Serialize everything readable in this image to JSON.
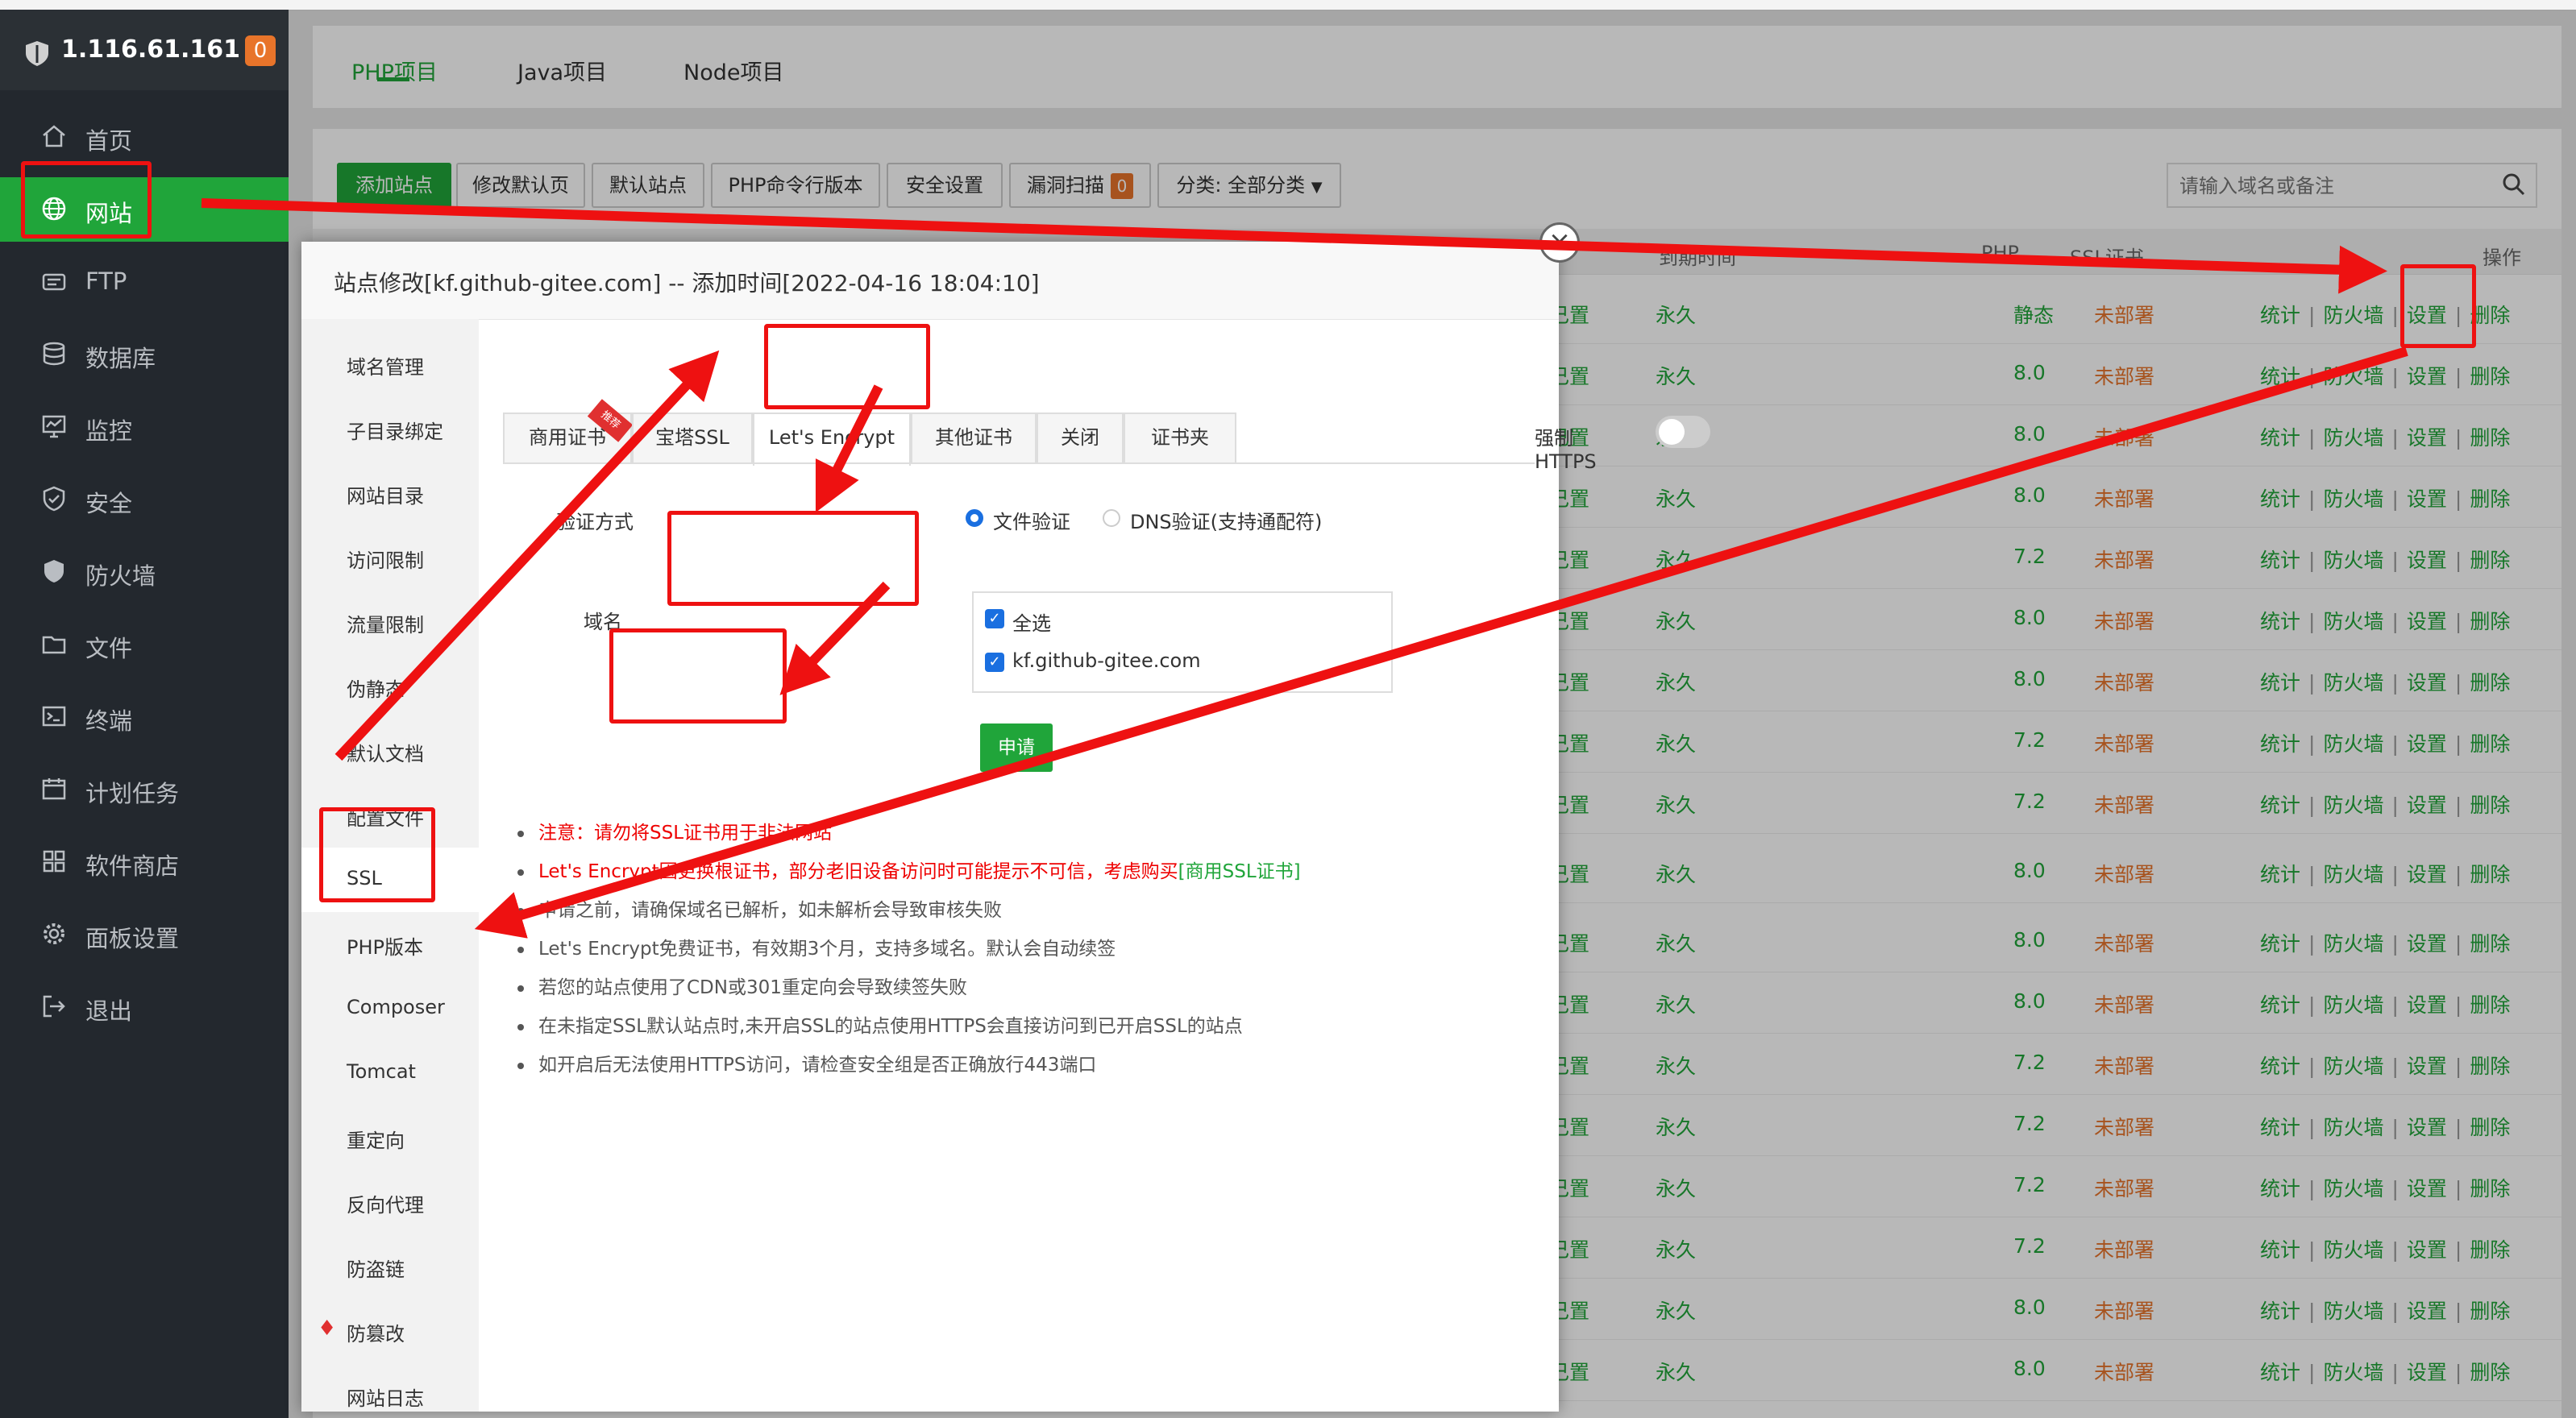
{
  "sidebar": {
    "server_ip": "1.116.61.161",
    "badge_count": "0",
    "items": [
      {
        "label": "首页",
        "icon": "home-icon"
      },
      {
        "label": "网站",
        "icon": "globe-icon",
        "active": true
      },
      {
        "label": "FTP",
        "icon": "ftp-icon"
      },
      {
        "label": "数据库",
        "icon": "database-icon"
      },
      {
        "label": "监控",
        "icon": "monitor-icon"
      },
      {
        "label": "安全",
        "icon": "shield-icon"
      },
      {
        "label": "防火墙",
        "icon": "firewall-icon"
      },
      {
        "label": "文件",
        "icon": "folder-icon"
      },
      {
        "label": "终端",
        "icon": "terminal-icon"
      },
      {
        "label": "计划任务",
        "icon": "calendar-icon"
      },
      {
        "label": "软件商店",
        "icon": "grid-icon"
      },
      {
        "label": "面板设置",
        "icon": "gear-icon"
      },
      {
        "label": "退出",
        "icon": "logout-icon"
      }
    ]
  },
  "project_tabs": [
    "PHP项目",
    "Java项目",
    "Node项目"
  ],
  "toolbar": {
    "add_site": "添加站点",
    "modify_default_page": "修改默认页",
    "default_site": "默认站点",
    "php_cli_version": "PHP命令行版本",
    "security_settings": "安全设置",
    "vuln_scan": "漏洞扫描",
    "vuln_count": "0",
    "category": "分类: 全部分类",
    "search_placeholder": "请输入域名或备注"
  },
  "table": {
    "headers": {
      "expire": "到期时间",
      "php": "PHP",
      "ssl": "SSL证书",
      "ops": "操作"
    },
    "ops_labels": {
      "stats": "统计",
      "firewall": "防火墙",
      "settings": "设置",
      "delete": "删除"
    },
    "rows": [
      {
        "note": "己置",
        "expire": "永久",
        "php": "静态",
        "ssl": "未部署"
      },
      {
        "note": "己置",
        "expire": "永久",
        "php": "8.0",
        "ssl": "未部署"
      },
      {
        "note": "己置",
        "expire": "永久",
        "php": "8.0",
        "ssl": "未部署"
      },
      {
        "note": "己置",
        "expire": "永久",
        "php": "8.0",
        "ssl": "未部署"
      },
      {
        "note": "己置",
        "expire": "永久",
        "php": "7.2",
        "ssl": "未部署"
      },
      {
        "note": "己置",
        "expire": "永久",
        "php": "8.0",
        "ssl": "未部署"
      },
      {
        "note": "己置",
        "expire": "永久",
        "php": "8.0",
        "ssl": "未部署"
      },
      {
        "note": "己置",
        "expire": "永久",
        "php": "7.2",
        "ssl": "未部署"
      },
      {
        "note": "己置",
        "expire": "永久",
        "php": "7.2",
        "ssl": "未部署"
      },
      {
        "note": "己置",
        "expire": "永久",
        "php": "8.0",
        "ssl": "未部署"
      },
      {
        "note": "己置",
        "expire": "永久",
        "php": "8.0",
        "ssl": "未部署"
      },
      {
        "note": "己置",
        "expire": "永久",
        "php": "8.0",
        "ssl": "未部署"
      },
      {
        "note": "己置",
        "expire": "永久",
        "php": "7.2",
        "ssl": "未部署"
      },
      {
        "note": "己置",
        "expire": "永久",
        "php": "7.2",
        "ssl": "未部署"
      },
      {
        "note": "己置",
        "expire": "永久",
        "php": "7.2",
        "ssl": "未部署"
      },
      {
        "note": "己置",
        "expire": "永久",
        "php": "7.2",
        "ssl": "未部署"
      },
      {
        "note": "己置",
        "expire": "永久",
        "php": "8.0",
        "ssl": "未部署"
      },
      {
        "note": "己置",
        "expire": "永久",
        "php": "8.0",
        "ssl": "未部署"
      }
    ]
  },
  "modal": {
    "title": "站点修改[kf.github-gitee.com] -- 添加时间[2022-04-16 18:04:10]",
    "close_glyph": "×",
    "nav": [
      "域名管理",
      "子目录绑定",
      "网站目录",
      "访问限制",
      "流量限制",
      "伪静态",
      "默认文档",
      "配置文件",
      "SSL",
      "PHP版本",
      "Composer",
      "Tomcat",
      "重定向",
      "反向代理",
      "防盗链",
      "防篡改",
      "网站日志"
    ],
    "ssl_tabs": [
      "商用证书",
      "宝塔SSL",
      "Let's Encrypt",
      "其他证书",
      "关闭",
      "证书夹"
    ],
    "ribbon": "推荐",
    "force_https": "强制HTTPS",
    "verify_label": "验证方式",
    "verify_file": "文件验证",
    "verify_dns": "DNS验证(支持通配符)",
    "domain_label": "域名",
    "select_all": "全选",
    "domain_value": "kf.github-gitee.com",
    "apply": "申请",
    "notes": [
      {
        "text": "注意：请勿将SSL证书用于非法网站",
        "red": true
      },
      {
        "text": "Let's Encrypt因更换根证书，部分老旧设备访问时可能提示不可信，考虑购买",
        "link": "[商用SSL证书]",
        "red": true
      },
      {
        "text": "申请之前，请确保域名已解析，如未解析会导致审核失败"
      },
      {
        "text": "Let's Encrypt免费证书，有效期3个月，支持多域名。默认会自动续签"
      },
      {
        "text": "若您的站点使用了CDN或301重定向会导致续签失败"
      },
      {
        "text": "在未指定SSL默认站点时,未开启SSL的站点使用HTTPS会直接访问到已开启SSL的站点"
      },
      {
        "text": "如开启后无法使用HTTPS访问，请检查安全组是否正确放行443端口"
      }
    ]
  },
  "colors": {
    "accent": "#20a53a",
    "sidebar": "#23282e",
    "annotation": "#ee1111",
    "warning": "#e8742a"
  }
}
